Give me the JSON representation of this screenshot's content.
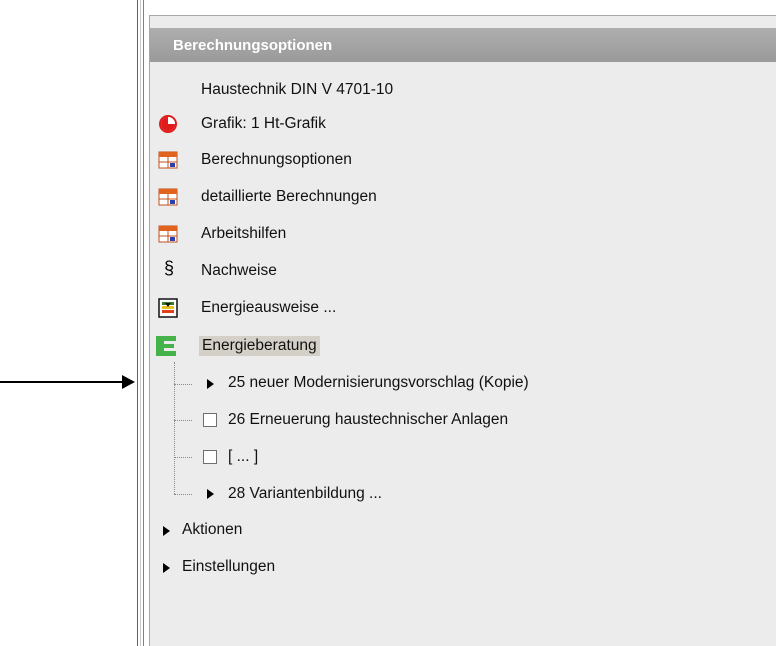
{
  "panel": {
    "title": "Berechnungsoptionen"
  },
  "items": [
    {
      "label": "Haustechnik DIN V 4701-10",
      "icon": "none"
    },
    {
      "label": "Grafik: 1 Ht-Grafik",
      "icon": "pie-chart-icon"
    },
    {
      "label": "Berechnungsoptionen",
      "icon": "table-icon"
    },
    {
      "label": "detaillierte Berechnungen",
      "icon": "table-icon"
    },
    {
      "label": "Arbeitshilfen",
      "icon": "table-icon"
    },
    {
      "label": "Nachweise",
      "icon": "section-sign-icon",
      "glyph": "§"
    },
    {
      "label": "Energieausweise ...",
      "icon": "certificate-icon"
    },
    {
      "label": "Energieberatung",
      "icon": "energy-e-icon",
      "selected": true
    }
  ],
  "subitems": [
    {
      "label": "25 neuer Modernisierungsvorschlag (Kopie)",
      "control": "expander"
    },
    {
      "label": "26 Erneuerung haustechnischer Anlagen",
      "control": "checkbox",
      "checked": false
    },
    {
      "label": "[ ... ]",
      "control": "checkbox",
      "checked": false
    },
    {
      "label": "28 Variantenbildung ...",
      "control": "expander"
    }
  ],
  "sections": [
    {
      "label": "Aktionen"
    },
    {
      "label": "Einstellungen"
    }
  ],
  "colors": {
    "header_bg": "#a5a5a5",
    "panel_bg": "#ececec",
    "energy_green": "#46b24a",
    "chart_red": "#e01b1b",
    "table_orange": "#e0641e"
  }
}
